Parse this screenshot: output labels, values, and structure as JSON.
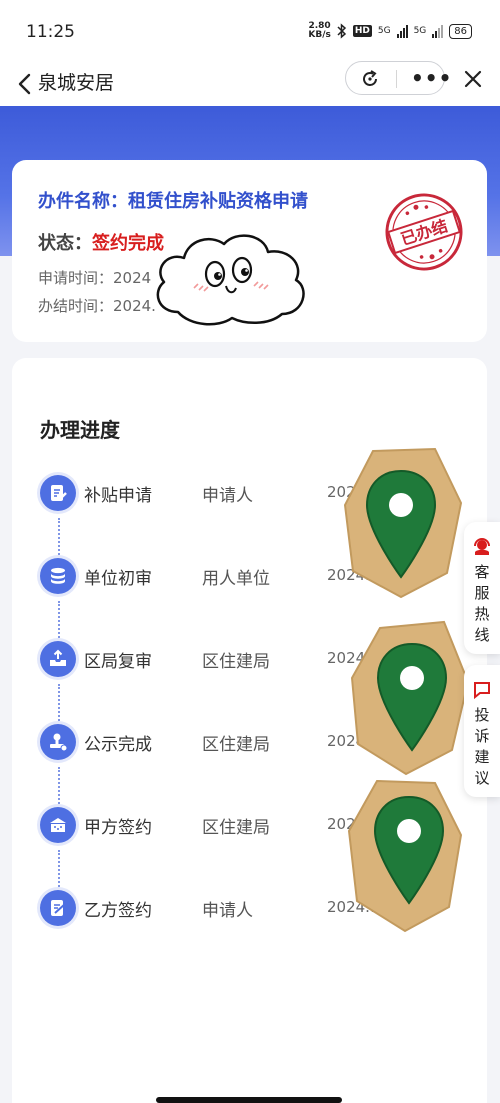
{
  "status_bar": {
    "time": "11:25",
    "net_speed_value": "2.80",
    "net_speed_unit": "KB/s",
    "hd": "HD",
    "sig1": "5G",
    "sig2": "5G",
    "battery": "86"
  },
  "nav": {
    "title": "泉城安居",
    "more": "•••"
  },
  "record": {
    "name_label": "办件名称：",
    "name": "租赁住房补贴资格申请",
    "status_label": "状态：",
    "status": "签约完成",
    "apply_time": "申请时间：2024",
    "finish_time": "办结时间：2024.",
    "stamp_text": "已办结"
  },
  "progress": {
    "title": "办理进度",
    "steps": [
      {
        "name": "补贴申请",
        "org": "申请人",
        "date": "2024"
      },
      {
        "name": "单位初审",
        "org": "用人单位",
        "date": "2024.1"
      },
      {
        "name": "区局复审",
        "org": "区住建局",
        "date": "2024.1"
      },
      {
        "name": "公示完成",
        "org": "区住建局",
        "date": "2024.1"
      },
      {
        "name": "甲方签约",
        "org": "区住建局",
        "date": "2024"
      },
      {
        "name": "乙方签约",
        "org": "申请人",
        "date": "2024.12"
      }
    ]
  },
  "side": {
    "hotline": "客服热线",
    "complaint": "投诉建议"
  },
  "colors": {
    "brand": "#4e6fe2",
    "title_blue": "#3250cc",
    "status_red": "#d81e1e",
    "stamp_red": "#c8283a",
    "pin_green": "#1f7a3a"
  }
}
